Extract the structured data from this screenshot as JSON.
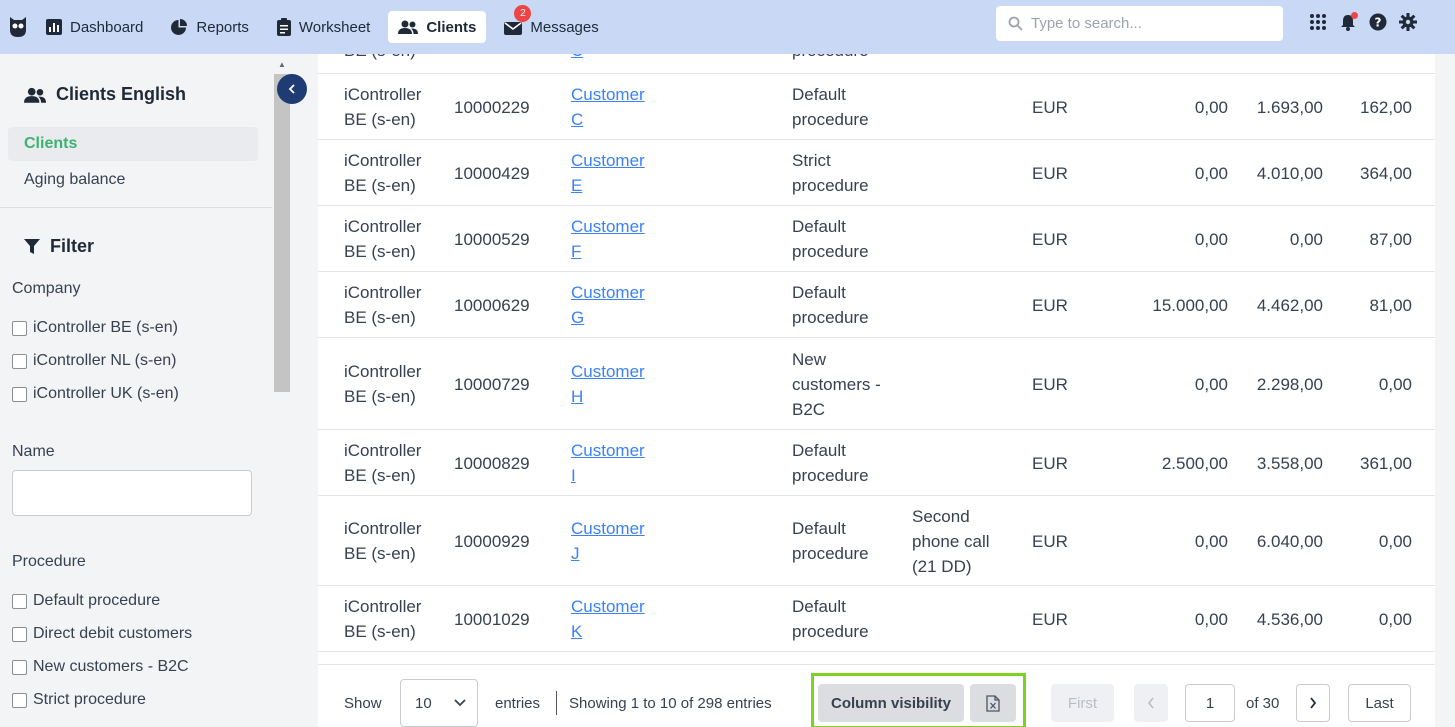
{
  "nav": {
    "items": [
      {
        "label": "Dashboard",
        "icon": "bar-chart-icon"
      },
      {
        "label": "Reports",
        "icon": "pie-chart-icon"
      },
      {
        "label": "Worksheet",
        "icon": "clipboard-icon"
      },
      {
        "label": "Clients",
        "icon": "users-icon"
      },
      {
        "label": "Messages",
        "icon": "envelope-icon",
        "badge": "2"
      }
    ],
    "search_placeholder": "Type to search..."
  },
  "sidebar": {
    "section_title": "Clients English",
    "links": [
      "Clients",
      "Aging balance"
    ],
    "filter_title": "Filter",
    "company_label": "Company",
    "companies": [
      "iController BE (s-en)",
      "iController NL (s-en)",
      "iController UK (s-en)"
    ],
    "name_label": "Name",
    "procedure_label": "Procedure",
    "procedures": [
      "Default procedure",
      "Direct debit customers",
      "New customers - B2C",
      "Strict procedure"
    ]
  },
  "table": {
    "partial_top": {
      "company": "BE (s-en)",
      "customer": "C",
      "procedure": "procedure"
    },
    "rows": [
      {
        "company": [
          "iController",
          "BE (s-en)"
        ],
        "number": "10000229",
        "customer": [
          "Customer",
          "C"
        ],
        "procedure": [
          "Default",
          "procedure"
        ],
        "step": [],
        "currency": "EUR",
        "v1": "0,00",
        "v2": "1.693,00",
        "v3": "162,00"
      },
      {
        "company": [
          "iController",
          "BE (s-en)"
        ],
        "number": "10000429",
        "customer": [
          "Customer",
          "E"
        ],
        "procedure": [
          "Strict",
          "procedure"
        ],
        "step": [],
        "currency": "EUR",
        "v1": "0,00",
        "v2": "4.010,00",
        "v3": "364,00"
      },
      {
        "company": [
          "iController",
          "BE (s-en)"
        ],
        "number": "10000529",
        "customer": [
          "Customer",
          "F"
        ],
        "procedure": [
          "Default",
          "procedure"
        ],
        "step": [],
        "currency": "EUR",
        "v1": "0,00",
        "v2": "0,00",
        "v3": "87,00"
      },
      {
        "company": [
          "iController",
          "BE (s-en)"
        ],
        "number": "10000629",
        "customer": [
          "Customer",
          "G"
        ],
        "procedure": [
          "Default",
          "procedure"
        ],
        "step": [],
        "currency": "EUR",
        "v1": "15.000,00",
        "v2": "4.462,00",
        "v3": "81,00"
      },
      {
        "company": [
          "iController",
          "BE (s-en)"
        ],
        "number": "10000729",
        "customer": [
          "Customer",
          "H"
        ],
        "procedure": [
          "New",
          "customers -",
          "B2C"
        ],
        "step": [],
        "currency": "EUR",
        "v1": "0,00",
        "v2": "2.298,00",
        "v3": "0,00"
      },
      {
        "company": [
          "iController",
          "BE (s-en)"
        ],
        "number": "10000829",
        "customer": [
          "Customer",
          "I"
        ],
        "procedure": [
          "Default",
          "procedure"
        ],
        "step": [],
        "currency": "EUR",
        "v1": "2.500,00",
        "v2": "3.558,00",
        "v3": "361,00"
      },
      {
        "company": [
          "iController",
          "BE (s-en)"
        ],
        "number": "10000929",
        "customer": [
          "Customer",
          "J"
        ],
        "procedure": [
          "Default",
          "procedure"
        ],
        "step": [
          "Second",
          "phone call",
          "(21 DD)"
        ],
        "currency": "EUR",
        "v1": "0,00",
        "v2": "6.040,00",
        "v3": "0,00"
      },
      {
        "company": [
          "iController",
          "BE (s-en)"
        ],
        "number": "10001029",
        "customer": [
          "Customer",
          "K"
        ],
        "procedure": [
          "Default",
          "procedure"
        ],
        "step": [],
        "currency": "EUR",
        "v1": "0,00",
        "v2": "4.536,00",
        "v3": "0,00"
      }
    ]
  },
  "footer": {
    "show_label": "Show",
    "page_size": "10",
    "entries_label": "entries",
    "showing_text": "Showing 1 to 10 of 298 entries",
    "column_visibility": "Column visibility",
    "first": "First",
    "page": "1",
    "of_text": "of 30",
    "last": "Last"
  }
}
